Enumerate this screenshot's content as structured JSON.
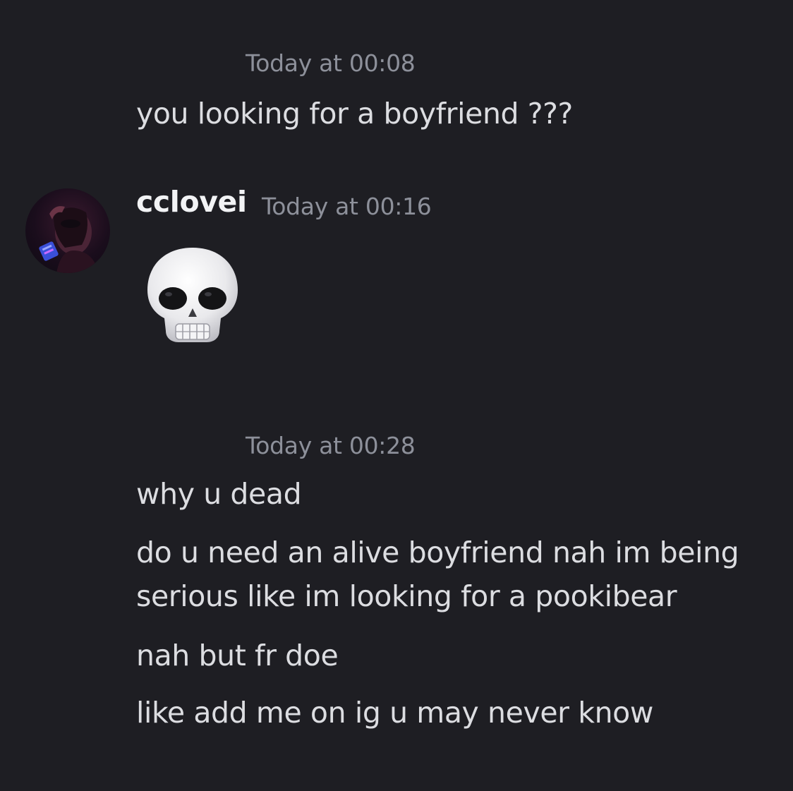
{
  "messages": {
    "group1": {
      "timestamp": "Today at 00:08",
      "lines": [
        "you looking for a boyfriend ???"
      ]
    },
    "group2": {
      "username": "cclovei",
      "timestamp": "Today at 00:16",
      "emoji": "skull-emoji"
    },
    "group3": {
      "timestamp": "Today at 00:28",
      "lines": [
        "why u dead",
        "do u need an alive boyfriend nah im being serious like im  looking for a pookibear",
        "nah but fr doe",
        "like add me on ig u may never know"
      ]
    }
  },
  "colors": {
    "background": "#1e1e23",
    "text": "#dcdde1",
    "timestamp": "#8d909a",
    "username": "#f2f3f5"
  }
}
